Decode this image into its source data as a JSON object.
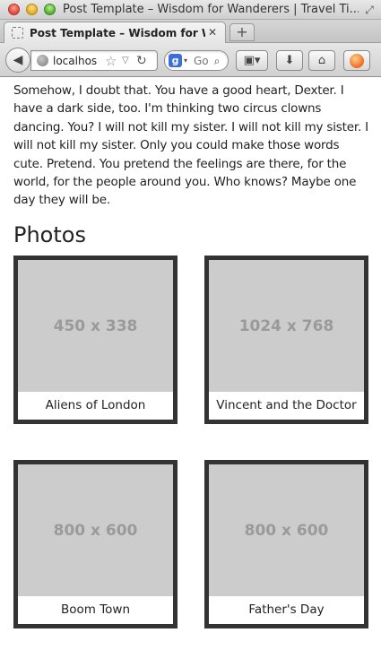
{
  "window": {
    "title": "Post Template – Wisdom for Wanderers | Travel Ti..."
  },
  "tabs": [
    {
      "label": "Post Template – Wisdom for Wa..."
    }
  ],
  "toolbar": {
    "url": "localhos",
    "search_placeholder": "Go",
    "search_engine_letter": "g"
  },
  "content": {
    "bio": "Somehow, I doubt that. You have a good heart, Dexter. I have a dark side, too. I'm thinking two circus clowns dancing. You? I will not kill my sister. I will not kill my sister. I will not kill my sister. Only you could make those words cute. Pretend. You pretend the feelings are there, for the world, for the people around you. Who knows? Maybe one day they will be.",
    "photos_heading": "Photos",
    "photos": [
      {
        "placeholder": "450 x 338",
        "caption": "Aliens of London"
      },
      {
        "placeholder": "1024 x 768",
        "caption": "Vincent and the Doctor"
      },
      {
        "placeholder": "800 x 600",
        "caption": "Boom Town"
      },
      {
        "placeholder": "800 x 600",
        "caption": "Father's Day"
      }
    ]
  },
  "colors": {
    "card_border": "#333333",
    "placeholder_bg": "#cccccc",
    "placeholder_text": "#9a9a9a"
  },
  "icons": {
    "back": "back-arrow-icon",
    "site": "globe-icon",
    "bookmark_star": "star-icon",
    "reload": "reload-icon",
    "search": "search-icon",
    "bookmarks": "bookmarks-icon",
    "download": "download-icon",
    "home": "home-icon",
    "addon": "addon-icon"
  }
}
